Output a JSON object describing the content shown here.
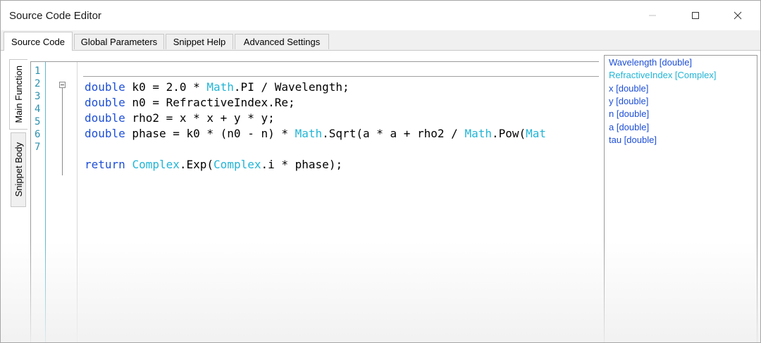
{
  "window": {
    "title": "Source Code Editor",
    "minimize_icon": "minimize-icon",
    "maximize_icon": "maximize-icon",
    "close_icon": "close-icon"
  },
  "tabs": [
    {
      "label": "Source Code",
      "active": true
    },
    {
      "label": "Global Parameters",
      "active": false
    },
    {
      "label": "Snippet Help",
      "active": false
    },
    {
      "label": "Advanced Settings",
      "active": false
    }
  ],
  "side_tabs": [
    {
      "label": "Main Function",
      "active": true
    },
    {
      "label": "Snippet Body",
      "active": false
    }
  ],
  "editor": {
    "line_numbers": [
      "1",
      "2",
      "3",
      "4",
      "5",
      "6",
      "7"
    ],
    "lines": [
      {
        "parts": []
      },
      {
        "parts": [
          {
            "t": "double",
            "c": "kw"
          },
          {
            "t": " k0 = 2.0 * ",
            "c": ""
          },
          {
            "t": "Math",
            "c": "ty"
          },
          {
            "t": ".PI / Wavelength;",
            "c": ""
          }
        ]
      },
      {
        "parts": [
          {
            "t": "double",
            "c": "kw"
          },
          {
            "t": " n0 = RefractiveIndex.Re;",
            "c": ""
          }
        ]
      },
      {
        "parts": [
          {
            "t": "double",
            "c": "kw"
          },
          {
            "t": " rho2 = x * x + y * y;",
            "c": ""
          }
        ]
      },
      {
        "parts": [
          {
            "t": "double",
            "c": "kw"
          },
          {
            "t": " phase = k0 * (n0 - n) * ",
            "c": ""
          },
          {
            "t": "Math",
            "c": "ty"
          },
          {
            "t": ".Sqrt(a * a + rho2 / ",
            "c": ""
          },
          {
            "t": "Math",
            "c": "ty"
          },
          {
            "t": ".Pow(",
            "c": ""
          },
          {
            "t": "Mat",
            "c": "ty"
          }
        ]
      },
      {
        "parts": []
      },
      {
        "parts": [
          {
            "t": "return",
            "c": "kw"
          },
          {
            "t": " ",
            "c": ""
          },
          {
            "t": "Complex",
            "c": "ty"
          },
          {
            "t": ".Exp(",
            "c": ""
          },
          {
            "t": "Complex",
            "c": "ty"
          },
          {
            "t": ".i * phase);",
            "c": ""
          }
        ]
      }
    ],
    "fold_icon": "collapse-icon"
  },
  "parameters": [
    {
      "label": "Wavelength [double]",
      "color": "#1e4fd6"
    },
    {
      "label": "RefractiveIndex [Complex]",
      "color": "#22b5d6"
    },
    {
      "label": "x [double]",
      "color": "#1e4fd6"
    },
    {
      "label": "y [double]",
      "color": "#1e4fd6"
    },
    {
      "label": "n [double]",
      "color": "#1e4fd6"
    },
    {
      "label": "a [double]",
      "color": "#1e4fd6"
    },
    {
      "label": "tau [double]",
      "color": "#1e4fd6"
    }
  ]
}
